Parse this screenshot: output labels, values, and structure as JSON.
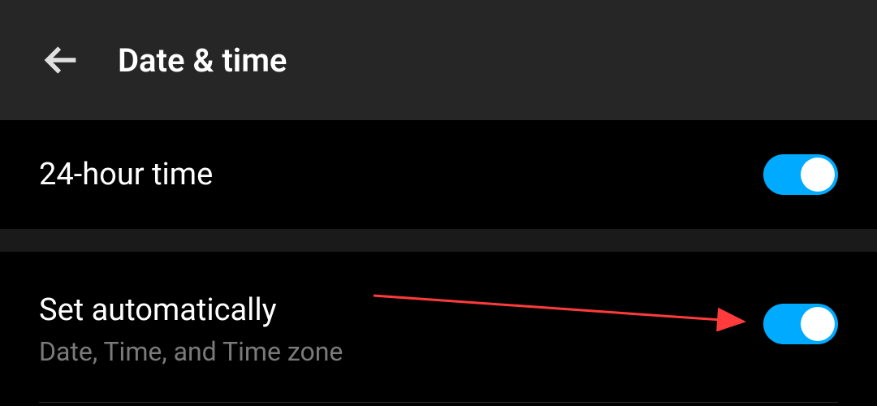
{
  "header": {
    "title": "Date & time"
  },
  "settings": {
    "item1": {
      "title": "24-hour time",
      "enabled": true
    },
    "item2": {
      "title": "Set automatically",
      "subtitle": "Date, Time, and Time zone",
      "enabled": true
    }
  },
  "colors": {
    "toggle_on": "#00aaff",
    "arrow": "#ff3b3b"
  }
}
